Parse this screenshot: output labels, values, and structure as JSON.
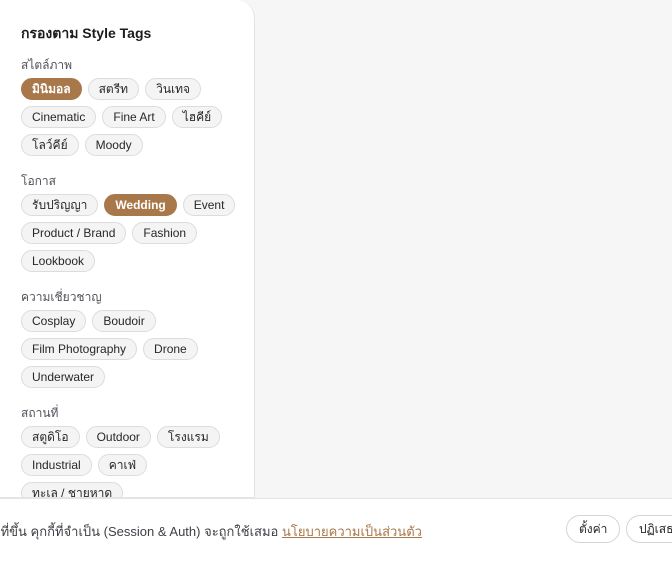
{
  "filter_panel": {
    "title": "กรองตาม Style Tags",
    "sections": [
      {
        "label": "สไตล์ภาพ",
        "tags": [
          {
            "label": "มินิมอล",
            "active": true
          },
          {
            "label": "สตรีท",
            "active": false
          },
          {
            "label": "วินเทจ",
            "active": false
          },
          {
            "label": "Cinematic",
            "active": false
          },
          {
            "label": "Fine Art",
            "active": false
          },
          {
            "label": "ไฮคีย์",
            "active": false
          },
          {
            "label": "โลว์คีย์",
            "active": false
          },
          {
            "label": "Moody",
            "active": false
          }
        ]
      },
      {
        "label": "โอกาส",
        "tags": [
          {
            "label": "รับปริญญา",
            "active": false
          },
          {
            "label": "Wedding",
            "active": true
          },
          {
            "label": "Event",
            "active": false
          },
          {
            "label": "Product / Brand",
            "active": false
          },
          {
            "label": "Fashion",
            "active": false
          },
          {
            "label": "Lookbook",
            "active": false
          }
        ]
      },
      {
        "label": "ความเชี่ยวชาญ",
        "tags": [
          {
            "label": "Cosplay",
            "active": false
          },
          {
            "label": "Boudoir",
            "active": false
          },
          {
            "label": "Film Photography",
            "active": false
          },
          {
            "label": "Drone",
            "active": false
          },
          {
            "label": "Underwater",
            "active": false
          }
        ]
      },
      {
        "label": "สถานที่",
        "tags": [
          {
            "label": "สตูดิโอ",
            "active": false
          },
          {
            "label": "Outdoor",
            "active": false
          },
          {
            "label": "โรงแรม",
            "active": false
          },
          {
            "label": "Industrial",
            "active": false
          },
          {
            "label": "คาเฟ่",
            "active": false
          },
          {
            "label": "ทะเล / ชายหาด",
            "active": false
          }
        ]
      }
    ]
  },
  "cookie_banner": {
    "text": "ที่ที่ขึ้น คุกกี้ที่จำเป็น (Session & Auth) จะถูกใช้เสมอ ",
    "policy_link": "นโยบายความเป็นส่วนตัว",
    "settings_label": "ตั้งค่า",
    "reject_label": "ปฏิเสธ"
  },
  "colors": {
    "accent": "#a8784a",
    "panel_bg": "#ffffff",
    "page_bg": "#f6f6f7"
  }
}
